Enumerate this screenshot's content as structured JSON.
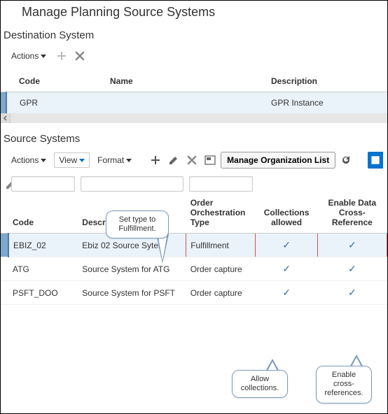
{
  "page_title": "Manage Planning Source Systems",
  "dest": {
    "title": "Destination System",
    "actions_label": "Actions",
    "columns": {
      "code": "Code",
      "name": "Name",
      "description": "Description"
    },
    "row": {
      "code": "GPR",
      "name": "",
      "description": "GPR Instance"
    }
  },
  "src": {
    "title": "Source Systems",
    "actions_label": "Actions",
    "view_label": "View",
    "format_label": "Format",
    "manage_org_label": "Manage Organization List",
    "columns": {
      "code": "Code",
      "description": "Description",
      "order_type": "Order Orchestration Type",
      "collections": "Collections allowed",
      "cross_ref": "Enable Data Cross-Reference"
    },
    "rows": [
      {
        "code": "EBIZ_02",
        "description": "Ebiz 02 Source Sytem",
        "order_type": "Fulfillment",
        "collections": "✓",
        "cross_ref": "✓",
        "selected": true,
        "highlight": true
      },
      {
        "code": "ATG",
        "description": "Source System for ATG",
        "order_type": "Order capture",
        "collections": "✓",
        "cross_ref": "✓"
      },
      {
        "code": "PSFT_DOO",
        "description": "Source System for PSFT",
        "order_type": "Order capture",
        "collections": "✓",
        "cross_ref": "✓"
      }
    ]
  },
  "callouts": {
    "type": "Set type to Fulfillment.",
    "collections": "Allow collections.",
    "crossref": "Enable cross-references."
  }
}
